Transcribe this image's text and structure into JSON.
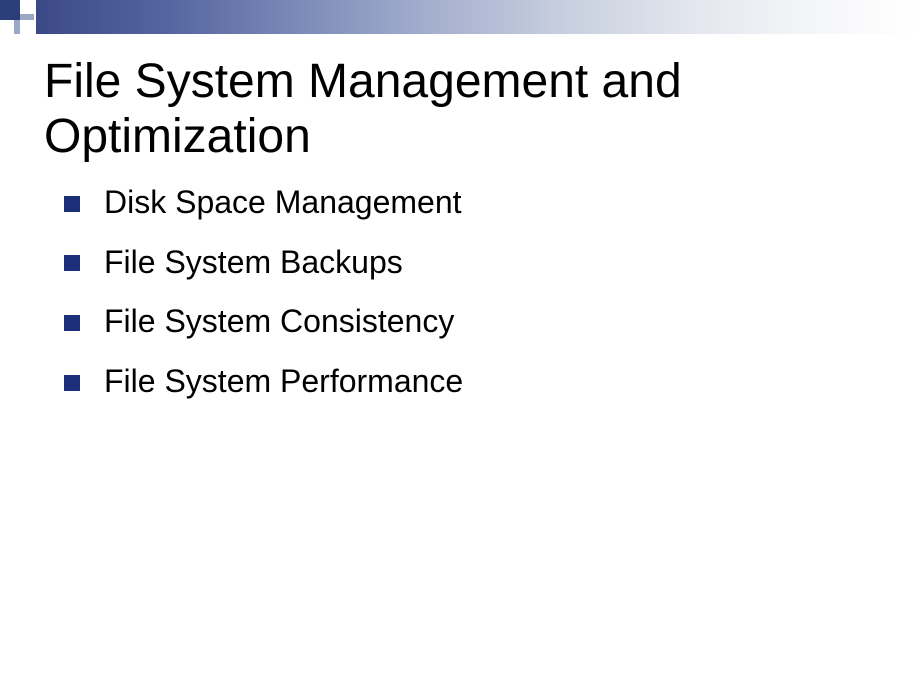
{
  "slide": {
    "title": "File System Management and Optimization",
    "bullets": [
      "Disk Space Management",
      "File System Backups",
      "File System Consistency",
      "File System Performance"
    ]
  }
}
